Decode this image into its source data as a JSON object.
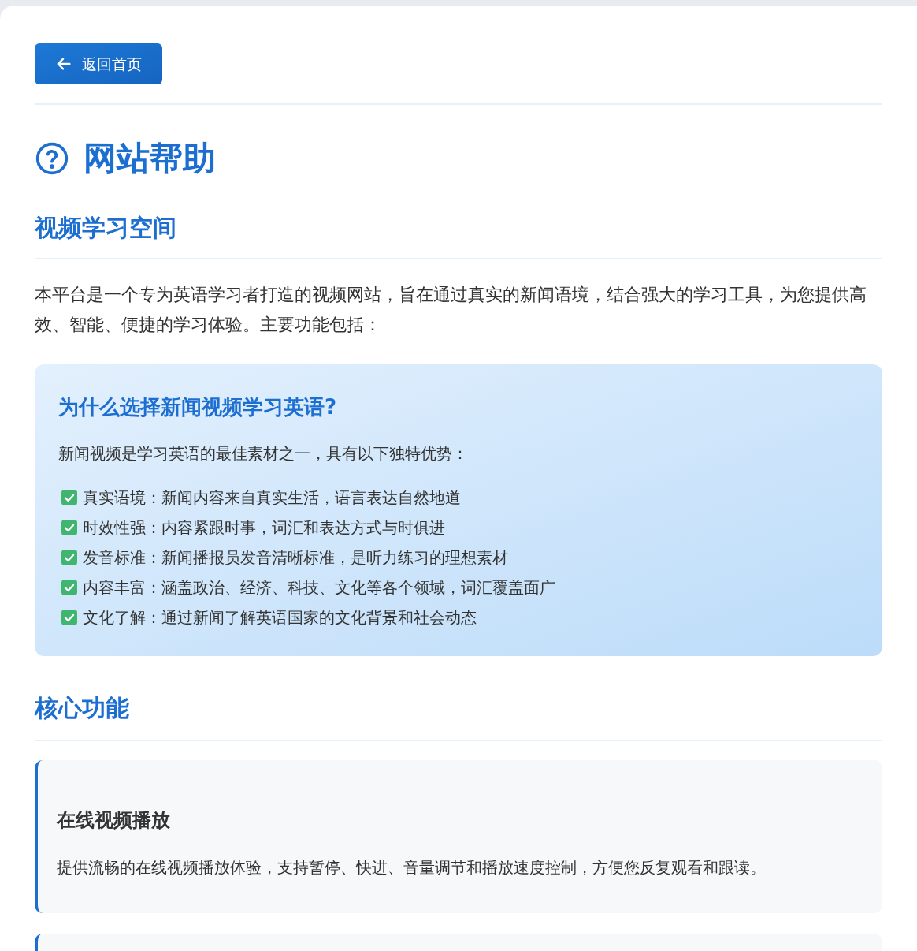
{
  "back_button": {
    "label": "返回首页"
  },
  "page_title": "网站帮助",
  "intro_section": {
    "heading": "视频学习空间",
    "paragraph": "本平台是一个专为英语学习者打造的视频网站，旨在通过真实的新闻语境，结合强大的学习工具，为您提供高效、智能、便捷的学习体验。主要功能包括：",
    "callout": {
      "title": "为什么选择新闻视频学习英语?",
      "lead": "新闻视频是学习英语的最佳素材之一，具有以下独特优势：",
      "points": [
        "真实语境：新闻内容来自真实生活，语言表达自然地道",
        "时效性强：内容紧跟时事，词汇和表达方式与时俱进",
        "发音标准：新闻播报员发音清晰标准，是听力练习的理想素材",
        "内容丰富：涵盖政治、经济、科技、文化等各个领域，词汇覆盖面广",
        "文化了解：通过新闻了解英语国家的文化背景和社会动态"
      ]
    }
  },
  "features_section": {
    "heading": "核心功能",
    "features": [
      {
        "title": "在线视频播放",
        "description": "提供流畅的在线视频播放体验，支持暂停、快进、音量调节和播放速度控制，方便您反复观看和跟读。"
      }
    ]
  }
}
